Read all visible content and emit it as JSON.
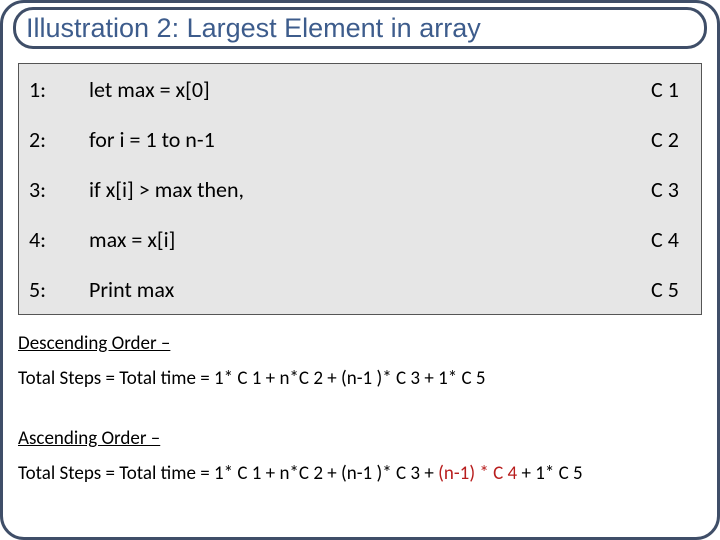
{
  "title": "Illustration 2: Largest Element in array",
  "code": {
    "rows": [
      {
        "n": "1:",
        "text": "let max = x[0]",
        "cost": "C 1",
        "indent": 0
      },
      {
        "n": "2:",
        "text": "for i = 1 to n-1",
        "cost": "C 2",
        "indent": 0
      },
      {
        "n": "3:",
        "text": "if x[i] > max then,",
        "cost": "C 3",
        "indent": 1
      },
      {
        "n": "4:",
        "text": "max = x[i]",
        "cost": "C 4",
        "indent": 2
      },
      {
        "n": "5:",
        "text": "Print max",
        "cost": "C 5",
        "indent": 0
      }
    ]
  },
  "analysis": {
    "descending": {
      "heading": "Descending Order –",
      "equation": "Total Steps = Total time = 1* C 1 + n*C 2 + (n-1 )* C 3  + 1* C 5"
    },
    "ascending": {
      "heading": "Ascending Order –",
      "prefix": "Total Steps = Total time = 1* C 1 + n*C 2 + (n-1 )* C 3 + ",
      "highlight": "(n-1) * C 4",
      "suffix": " + 1* C 5"
    }
  }
}
